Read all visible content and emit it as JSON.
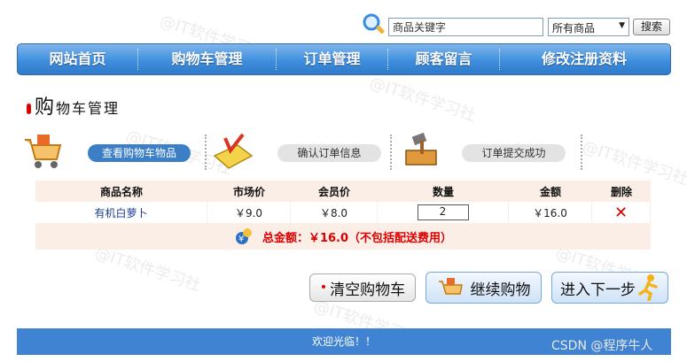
{
  "watermark": "@IT软件学习社",
  "search": {
    "placeholder": "商品关键字",
    "value": "商品关键字",
    "category": "所有商品",
    "button": "搜索"
  },
  "nav": {
    "items": [
      {
        "label": "网站首页"
      },
      {
        "label": "购物车管理"
      },
      {
        "label": "订单管理"
      },
      {
        "label": "顾客留言"
      },
      {
        "label": "修改注册资料"
      }
    ]
  },
  "page": {
    "title_big": "购",
    "title_rest": "物车管理"
  },
  "steps": [
    {
      "label": "查看购物车物品",
      "active": true
    },
    {
      "label": "确认订单信息",
      "active": false
    },
    {
      "label": "订单提交成功",
      "active": false
    }
  ],
  "table": {
    "headers": [
      "商品名称",
      "市场价",
      "会员价",
      "数量",
      "金额",
      "删除"
    ],
    "rows": [
      {
        "name": "有机白萝卜",
        "market_price": "￥9.0",
        "member_price": "￥8.0",
        "qty": "2",
        "amount": "￥16.0"
      }
    ],
    "total": "总金额：￥16.0（不包括配送费用）"
  },
  "buttons": {
    "clear": "清空购物车",
    "continue": "继续购物",
    "next": "进入下一步"
  },
  "footer": {
    "text": "欢迎光临！！",
    "credit": "CSDN @程序牛人"
  },
  "colors": {
    "nav": "#3f8fde",
    "accent": "#3c7fc7",
    "price_total": "#dd0000"
  }
}
